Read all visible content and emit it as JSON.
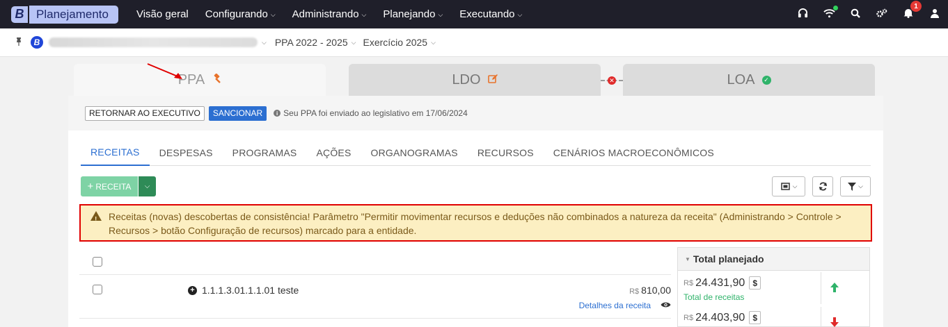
{
  "app": {
    "brand_letter": "B",
    "brand_name": "Planejamento"
  },
  "menu": [
    {
      "label": "Visão geral",
      "has_caret": false
    },
    {
      "label": "Configurando",
      "has_caret": true
    },
    {
      "label": "Administrando",
      "has_caret": true
    },
    {
      "label": "Planejando",
      "has_caret": true
    },
    {
      "label": "Executando",
      "has_caret": true
    }
  ],
  "nav_icons": {
    "notification_count": "1"
  },
  "context": {
    "entity_letter": "B",
    "ppa": "PPA 2022 - 2025",
    "exercise": "Exercício 2025"
  },
  "phases": {
    "ppa": "PPA",
    "ldo": "LDO",
    "loa": "LOA"
  },
  "actions": {
    "return_label": "RETORNAR AO EXECUTIVO",
    "sanction_label": "SANCIONAR",
    "info_text": "Seu PPA foi enviado ao legislativo em 17/06/2024"
  },
  "subtabs": [
    "RECEITAS",
    "DESPESAS",
    "PROGRAMAS",
    "AÇÕES",
    "ORGANOGRAMAS",
    "RECURSOS",
    "CENÁRIOS MACROECONÔMICOS"
  ],
  "add_button": {
    "label": "RECEITA"
  },
  "alert": {
    "text": "Receitas (novas) descobertas de consistência! Parâmetro \"Permitir movimentar recursos e deduções não combinados a natureza da receita\" (Administrando > Controle > Recursos > botão Configuração de recursos) marcado para a entidade."
  },
  "rows": [
    {
      "code": "1.1.1.3.01.1.1.01 teste",
      "currency": "R$",
      "value": "810,00",
      "details": "Detalhes da receita"
    }
  ],
  "side": {
    "title": "Total planejado",
    "items": [
      {
        "currency": "R$",
        "value": "24.431,90",
        "label": "Total de receitas",
        "direction": "up"
      },
      {
        "currency": "R$",
        "value": "24.403,90",
        "label": "",
        "direction": "down"
      }
    ]
  },
  "colors": {
    "accent": "#2c6fd1",
    "alert_border": "#e00000",
    "alert_bg": "#fcefc2",
    "success": "#2fb36a",
    "danger": "#e02b2b"
  }
}
